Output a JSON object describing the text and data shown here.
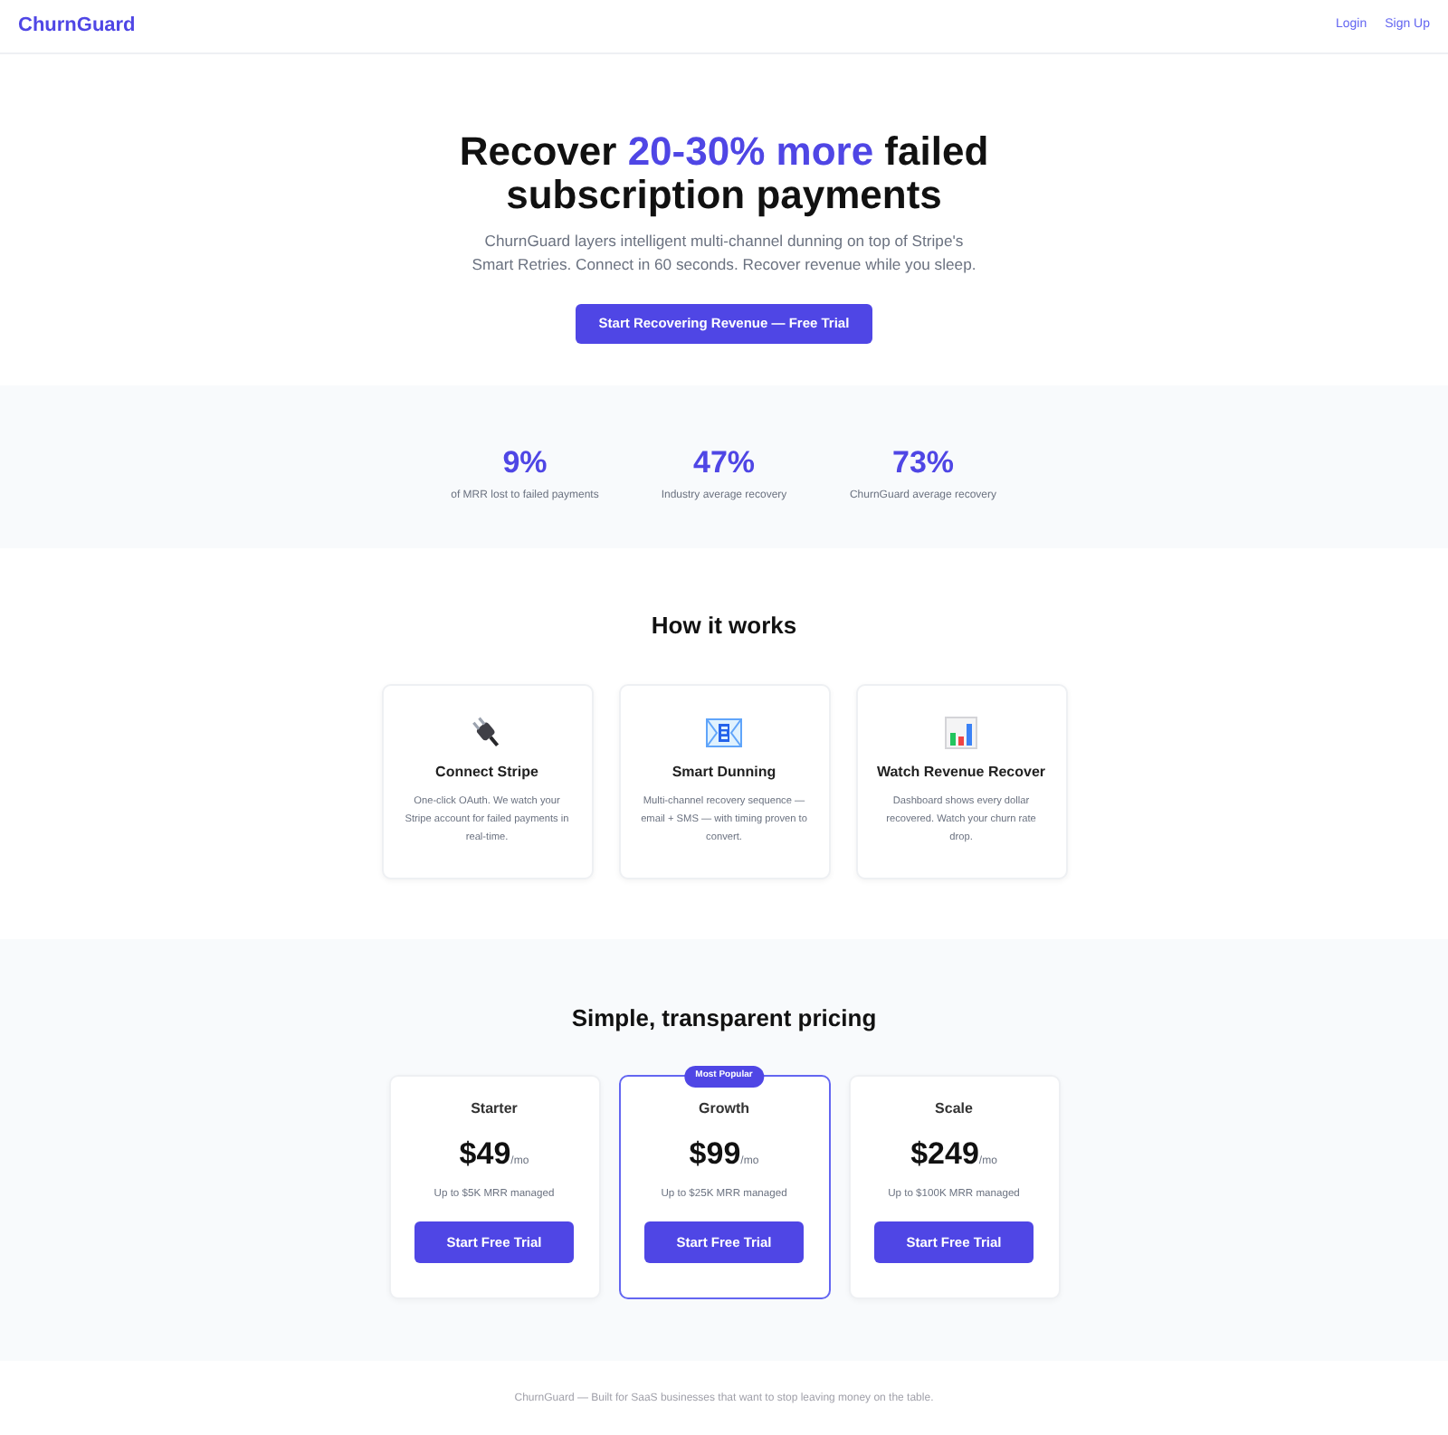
{
  "header": {
    "logo": "ChurnGuard",
    "links": [
      "Login",
      "Sign Up"
    ]
  },
  "hero": {
    "title": {
      "before": "Recover ",
      "highlight": "20-30% more",
      "after": " failed subscription payments"
    },
    "subtitle": "ChurnGuard layers intelligent multi-channel dunning on top of Stripe's Smart Retries. Connect in 60 seconds. Recover revenue while you sleep.",
    "cta": "Start Recovering Revenue — Free Trial"
  },
  "stats": [
    {
      "value": "9%",
      "label": "of MRR lost to failed payments"
    },
    {
      "value": "47%",
      "label": "Industry average recovery"
    },
    {
      "value": "73%",
      "label": "ChurnGuard average recovery"
    }
  ],
  "how_it_works": {
    "heading": "How it works",
    "steps": [
      {
        "kind": "plug",
        "title": "Connect Stripe",
        "text": "One-click OAuth. We watch your Stripe account for failed payments in real-time."
      },
      {
        "kind": "envelope",
        "title": "Smart Dunning",
        "text": "Multi-channel recovery sequence — email + SMS — with timing proven to convert."
      },
      {
        "kind": "chart",
        "title": "Watch Revenue Recover",
        "text": "Dashboard shows every dollar recovered. Watch your churn rate drop."
      }
    ]
  },
  "pricing": {
    "heading": "Simple, transparent pricing",
    "plans": [
      {
        "name": "Starter",
        "price": "$49",
        "period": "/mo",
        "limit": "Up to $5K MRR managed",
        "button": "Start Free Trial",
        "featured": false
      },
      {
        "name": "Growth",
        "badge": "Most Popular",
        "price": "$99",
        "period": "/mo",
        "limit": "Up to $25K MRR managed",
        "button": "Start Free Trial",
        "featured": true
      },
      {
        "name": "Scale",
        "price": "$249",
        "period": "/mo",
        "limit": "Up to $100K MRR managed",
        "button": "Start Free Trial",
        "featured": false
      }
    ]
  },
  "footer": {
    "text": "ChurnGuard — Built for SaaS businesses that want to stop leaving money on the table."
  }
}
